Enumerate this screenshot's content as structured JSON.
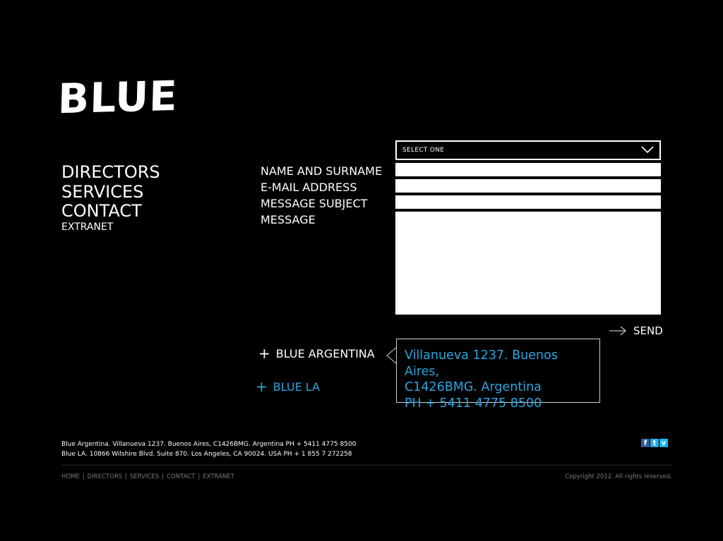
{
  "brand": {
    "logo_text": "BLUE"
  },
  "nav": {
    "directors": "DIRECTORS",
    "services": "SERVICES",
    "contact": "CONTACT",
    "extranet": "EXTRANET"
  },
  "form": {
    "select_placeholder": "SELECT ONE",
    "labels": {
      "name": "NAME AND SURNAME",
      "email": "E-MAIL ADDRESS",
      "subject": "MESSAGE SUBJECT",
      "message": "MESSAGE"
    },
    "send_label": "SEND"
  },
  "offices": {
    "argentina": {
      "label": "BLUE ARGENTINA",
      "address_line1": "Villanueva 1237. Buenos Aires,",
      "address_line2": "C1426BMG. Argentina",
      "phone": "PH + 5411 4775 8500"
    },
    "la": {
      "label": "BLUE LA"
    }
  },
  "footer": {
    "address_argentina": "Blue Argentina. Villanueva 1237. Buenos Aires, C1426BMG. Argentina PH + 5411 4775 8500",
    "address_la": "Blue LA. 10866 Wilshire Blvd. Suite 870. Los Angeles, CA 90024. USA PH + 1 855 7 272258",
    "nav": [
      "HOME",
      "DIRECTORS",
      "SERVICES",
      "CONTACT",
      "EXTRANET"
    ],
    "copyright": "Copyright 2012. All rights reserved."
  },
  "social": {
    "facebook_glyph": "f",
    "twitter_glyph": "t",
    "vimeo_glyph": "v"
  },
  "colors": {
    "background": "#000000",
    "accent_blue": "#2aa6e0",
    "facebook": "#3b5998",
    "twitter": "#2fa9e0",
    "vimeo": "#1ab7ea",
    "footer_text": "#7a7a7a"
  },
  "icons": {
    "select": "chevron-down-icon",
    "send": "arrow-right-icon",
    "office": "plus-icon"
  }
}
